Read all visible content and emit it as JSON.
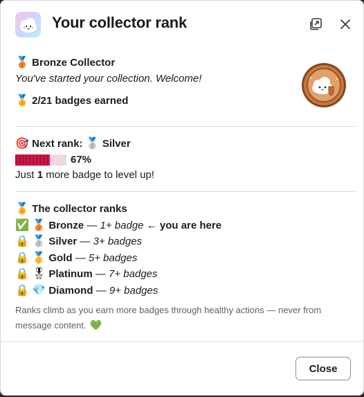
{
  "header": {
    "title": "Your collector rank",
    "app_icon": "cloud-mascot-icon",
    "actions": [
      "popout-icon",
      "close-icon"
    ]
  },
  "current_rank": {
    "emoji": "🥉",
    "name": "Bronze Collector",
    "message": "You've started your collection. Welcome!",
    "badges_emoji": "🏅",
    "badges_earned": "2/21 badges earned",
    "image": "bronze-cloud-badge-icon"
  },
  "next_rank": {
    "target_emoji": "🎯",
    "label": "Next rank:",
    "medal_emoji": "🥈",
    "name": "Silver",
    "progress_percent": 67,
    "progress_text": "67%",
    "level_text_prefix": "Just ",
    "level_text_count": "1",
    "level_text_suffix": " more badge to level up!"
  },
  "ranks": {
    "heading_emoji": "🏅",
    "heading": "The collector ranks",
    "items": [
      {
        "status_emoji": "✅",
        "medal_emoji": "🥉",
        "name": "Bronze",
        "requirement": "1+ badge",
        "here": "← you are here"
      },
      {
        "status_emoji": "🔒",
        "medal_emoji": "🥈",
        "name": "Silver",
        "requirement": "3+ badges"
      },
      {
        "status_emoji": "🔒",
        "medal_emoji": "🥇",
        "name": "Gold",
        "requirement": "5+ badges"
      },
      {
        "status_emoji": "🔒",
        "medal_emoji": "🎖",
        "name": "Platinum",
        "requirement": "7+ badges"
      },
      {
        "status_emoji": "🔒",
        "medal_emoji": "💎",
        "name": "Diamond",
        "requirement": "9+ badges"
      }
    ],
    "dash": "—",
    "note": "Ranks climb as you earn more badges through healthy actions — never from message content.",
    "note_emoji": "💚"
  },
  "footer": {
    "close_label": "Close"
  },
  "colors": {
    "progress_fill": "#c0163f",
    "progress_track": "#f3d7dc",
    "bronze": "#b8672e"
  }
}
